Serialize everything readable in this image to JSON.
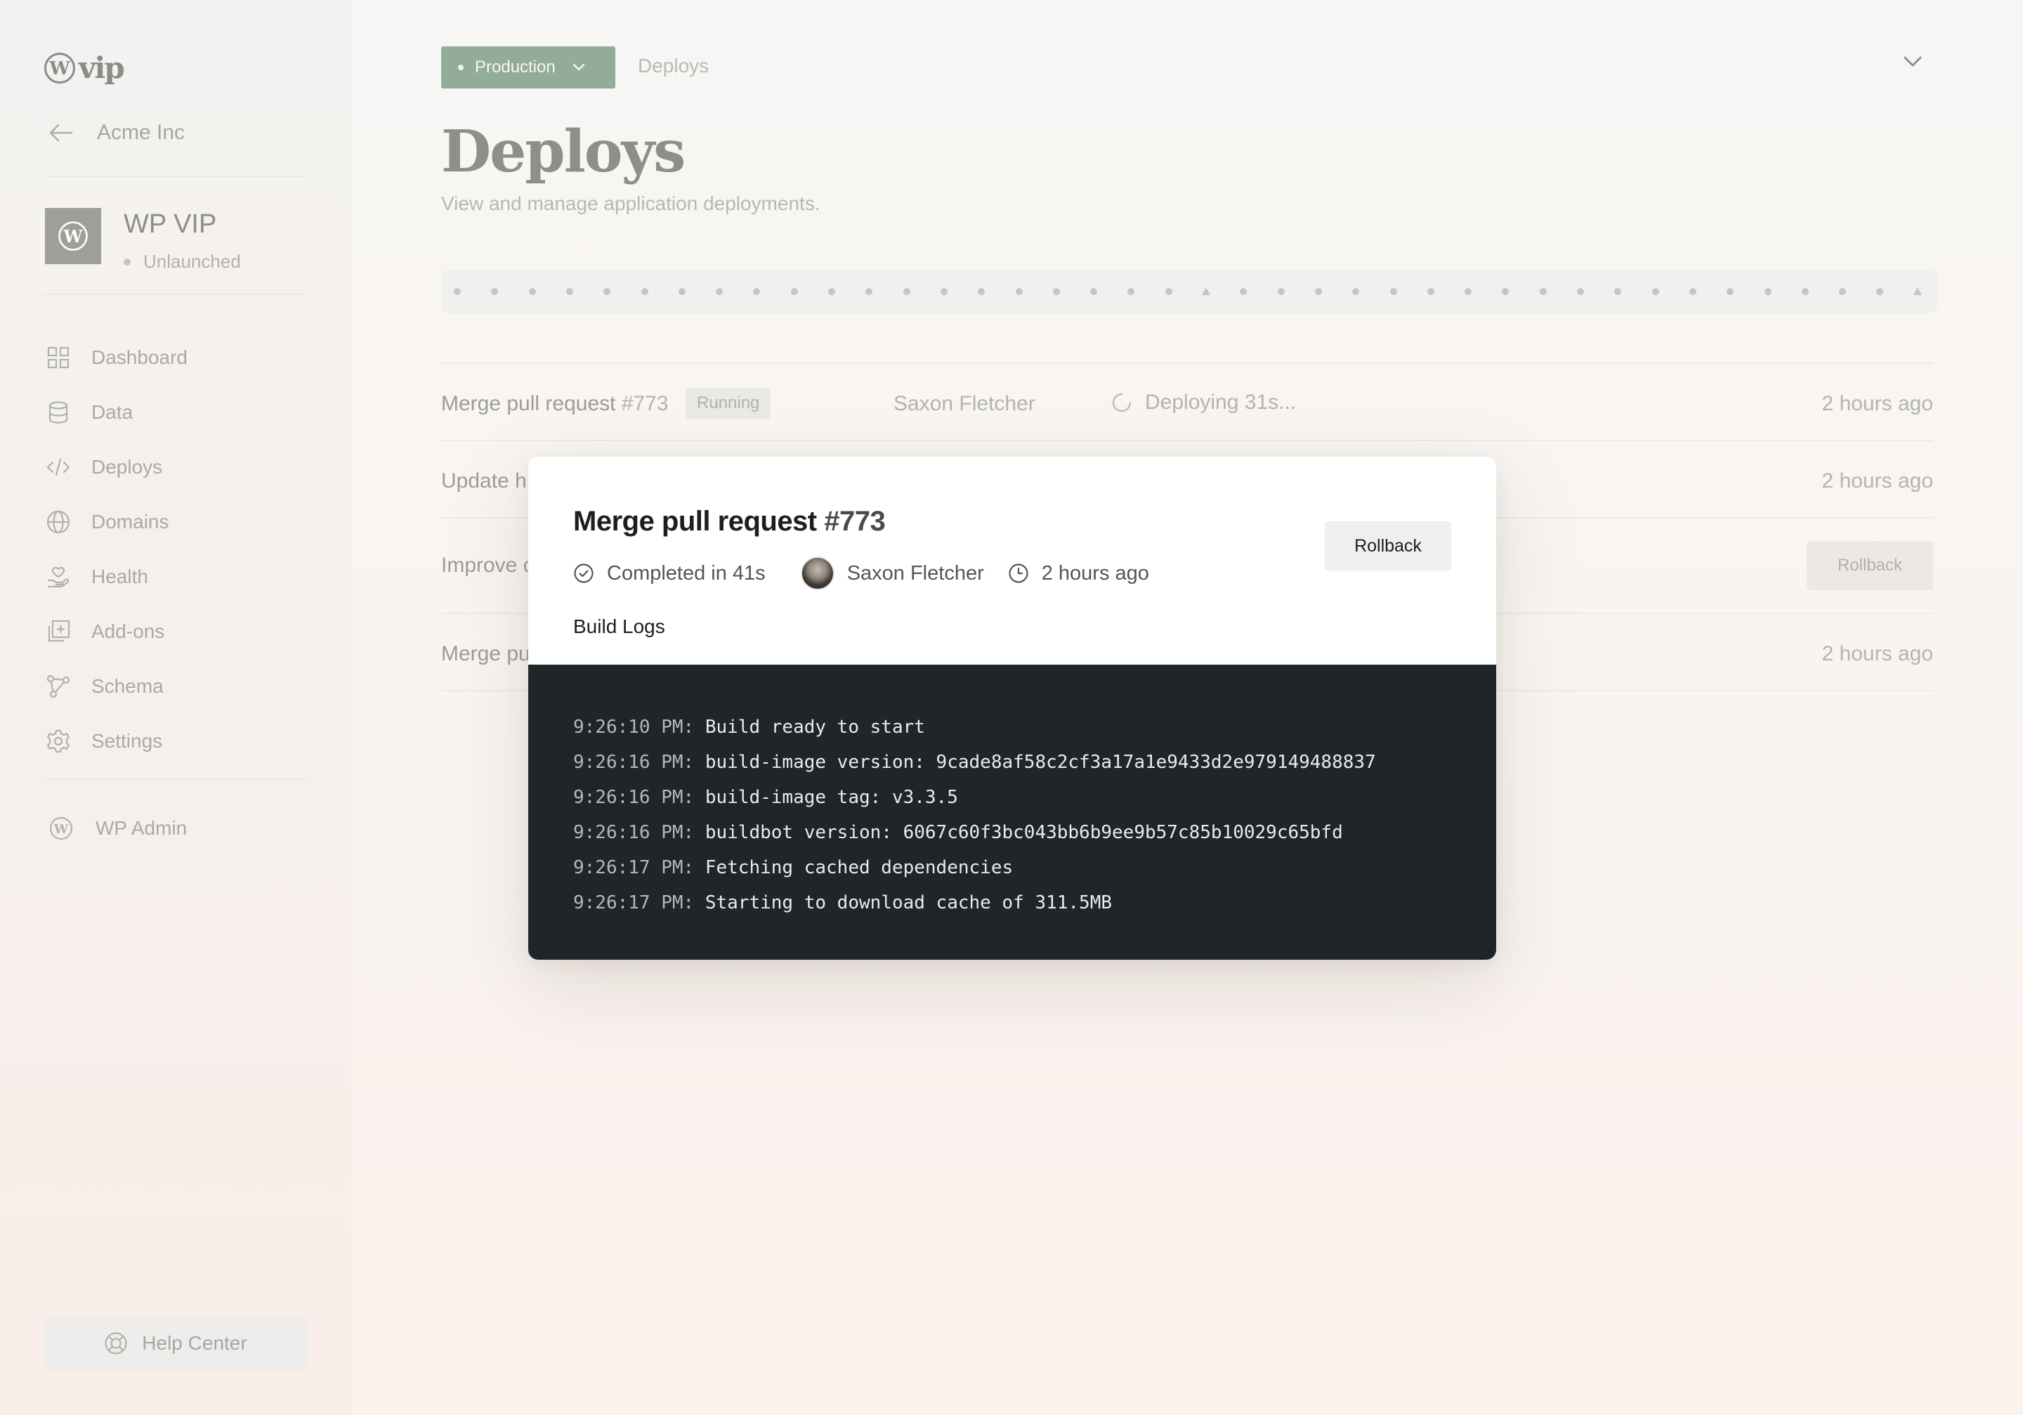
{
  "sidebar": {
    "logo_text": "vip",
    "org_name": "Acme Inc",
    "site_name": "WP VIP",
    "site_status": "Unlaunched",
    "nav_items": [
      {
        "label": "Dashboard",
        "icon": "grid-icon"
      },
      {
        "label": "Data",
        "icon": "database-icon"
      },
      {
        "label": "Deploys",
        "icon": "code-icon"
      },
      {
        "label": "Domains",
        "icon": "globe-icon"
      },
      {
        "label": "Health",
        "icon": "health-icon"
      },
      {
        "label": "Add-ons",
        "icon": "add-ons-icon"
      },
      {
        "label": "Schema",
        "icon": "schema-icon"
      },
      {
        "label": "Settings",
        "icon": "gear-icon"
      }
    ],
    "wp_admin_label": "WP Admin",
    "help_center_label": "Help Center"
  },
  "header": {
    "environment": "Production",
    "breadcrumb": "Deploys",
    "title": "Deploys",
    "subtitle": "View and manage application deployments."
  },
  "timeline": {
    "marker_count": 40,
    "triangle_markers": [
      21,
      40
    ],
    "color": "#bfc8c1"
  },
  "deploys": [
    {
      "title": "Merge pull request",
      "number": "#773",
      "badge": "Running",
      "author": "Saxon Fletcher",
      "status": "Deploying 31s...",
      "time": "2 hours ago"
    },
    {
      "title_partial": "Update h",
      "time": "2 hours ago"
    },
    {
      "title_partial": "Improve c",
      "rollback_label": "Rollback"
    },
    {
      "title_partial": "Merge pu",
      "time": "2 hours ago"
    }
  ],
  "modal": {
    "title": "Merge pull request",
    "number": "#773",
    "completed": "Completed in 41s",
    "author": "Saxon Fletcher",
    "time": "2 hours ago",
    "rollback_label": "Rollback",
    "build_logs_label": "Build Logs",
    "logs": [
      {
        "ts": "9:26:10 PM:",
        "msg": "Build ready to start"
      },
      {
        "ts": "9:26:16 PM:",
        "msg": "build-image version: 9cade8af58c2cf3a17a1e9433d2e979149488837"
      },
      {
        "ts": "9:26:16 PM:",
        "msg": "build-image tag: v3.3.5"
      },
      {
        "ts": "9:26:16 PM:",
        "msg": "buildbot version: 6067c60f3bc043bb6b9ee9b57c85b10029c65bfd"
      },
      {
        "ts": "9:26:17 PM:",
        "msg": "Fetching cached dependencies"
      },
      {
        "ts": "9:26:17 PM:",
        "msg": "Starting to download cache of 311.5MB"
      }
    ]
  },
  "colors": {
    "accent": "#93ac98",
    "log_background": "#20252a"
  }
}
